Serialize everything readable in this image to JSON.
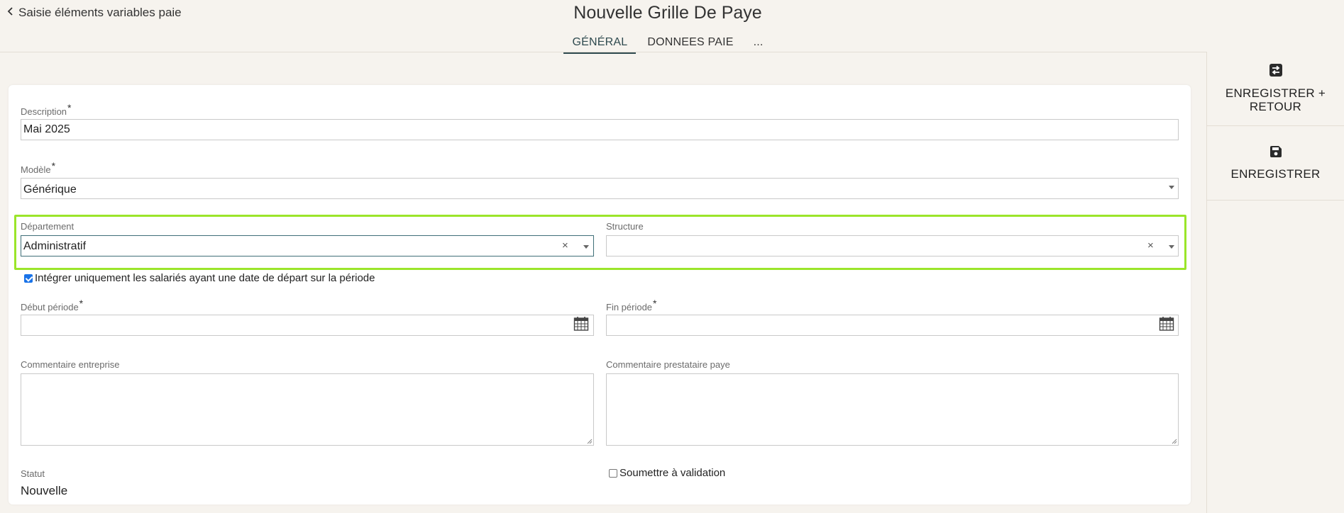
{
  "header": {
    "back_label": "Saisie éléments variables paie",
    "title": "Nouvelle Grille De Paye",
    "tabs": [
      "GÉNÉRAL",
      "DONNEES PAIE",
      "..."
    ]
  },
  "actions": {
    "save_return_line1": "ENREGISTRER +",
    "save_return_line2": "RETOUR",
    "save": "ENREGISTRER"
  },
  "form": {
    "description": {
      "label": "Description",
      "value": "Mai 2025"
    },
    "modele": {
      "label": "Modèle",
      "value": "Générique"
    },
    "departement": {
      "label": "Département",
      "value": "Administratif"
    },
    "structure": {
      "label": "Structure",
      "value": ""
    },
    "integrer_checkbox": {
      "label": "Intégrer uniquement les salariés ayant une date de départ sur la période",
      "checked": true
    },
    "debut_periode": {
      "label": "Début période",
      "value": ""
    },
    "fin_periode": {
      "label": "Fin période",
      "value": ""
    },
    "commentaire_entreprise": {
      "label": "Commentaire entreprise",
      "value": ""
    },
    "commentaire_prestataire": {
      "label": "Commentaire prestataire paye",
      "value": ""
    },
    "statut": {
      "label": "Statut",
      "value": "Nouvelle"
    },
    "soumettre_checkbox": {
      "label": "Soumettre à validation",
      "checked": false
    },
    "required_mark": "*"
  },
  "colors": {
    "background": "#f6f3ee",
    "highlight": "#9be52a",
    "active_tab": "#2f4a4f"
  },
  "icons": [
    "chevron-left-icon",
    "save-return-icon",
    "save-icon",
    "calendar-icon",
    "clear-icon",
    "dropdown-arrow-icon"
  ]
}
